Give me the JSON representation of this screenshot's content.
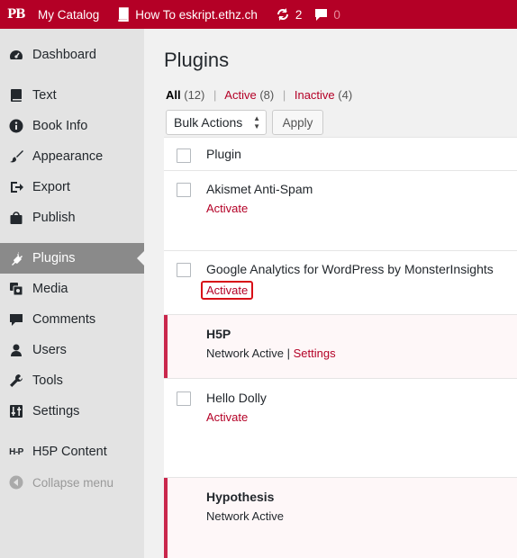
{
  "adminbar": {
    "logo": "PB",
    "catalog": "My Catalog",
    "book": "How To eskript.ethz.ch",
    "updates_count": "2",
    "comments_count": "0"
  },
  "sidebar": {
    "items": [
      {
        "label": "Dashboard",
        "icon": "dashboard-icon"
      },
      {
        "label": "Text",
        "icon": "book-icon"
      },
      {
        "label": "Book Info",
        "icon": "info-icon"
      },
      {
        "label": "Appearance",
        "icon": "paintbrush-icon"
      },
      {
        "label": "Export",
        "icon": "export-icon"
      },
      {
        "label": "Publish",
        "icon": "shop-icon"
      },
      {
        "label": "Plugins",
        "icon": "plugins-icon"
      },
      {
        "label": "Media",
        "icon": "media-icon"
      },
      {
        "label": "Comments",
        "icon": "comment-icon"
      },
      {
        "label": "Users",
        "icon": "users-icon"
      },
      {
        "label": "Tools",
        "icon": "wrench-icon"
      },
      {
        "label": "Settings",
        "icon": "settings-icon"
      },
      {
        "label": "H5P Content",
        "icon": "h5p-icon"
      },
      {
        "label": "Collapse menu",
        "icon": "collapse-icon"
      }
    ]
  },
  "page": {
    "title": "Plugins",
    "filters": {
      "all": "All",
      "all_count": "(12)",
      "active": "Active",
      "active_count": "(8)",
      "inactive": "Inactive",
      "inactive_count": "(4)",
      "separator": "|"
    },
    "bulk_actions": "Bulk Actions",
    "apply": "Apply",
    "column_plugin": "Plugin"
  },
  "plugins": [
    {
      "name": "Akismet Anti-Spam",
      "action": "Activate",
      "status": "inactive"
    },
    {
      "name": "Google Analytics for WordPress by MonsterInsights",
      "action": "Activate",
      "status": "inactive",
      "highlighted": true
    },
    {
      "name": "H5P",
      "action": "Network Active",
      "action_sep": "|",
      "action2": "Settings",
      "status": "network-active"
    },
    {
      "name": "Hello Dolly",
      "action": "Activate",
      "status": "inactive"
    },
    {
      "name": "Hypothesis",
      "action": "Network Active",
      "status": "network-active"
    }
  ],
  "colors": {
    "brand": "#b40026",
    "active_row_bg": "#fef7f8",
    "active_row_border": "#c9274c",
    "highlight_outline": "#d80f17"
  }
}
